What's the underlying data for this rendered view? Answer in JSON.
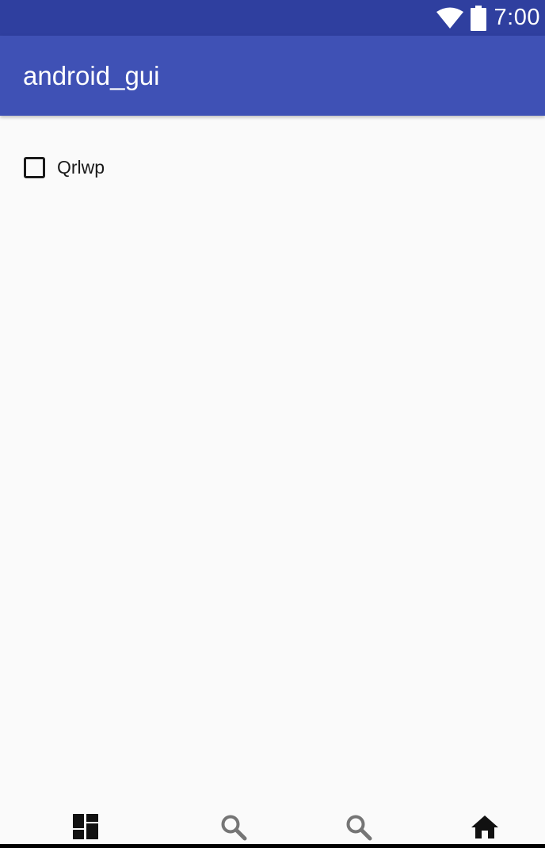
{
  "status_bar": {
    "time": "7:00",
    "icons": [
      "wifi-icon",
      "battery-icon"
    ]
  },
  "app_bar": {
    "title": "android_gui"
  },
  "content": {
    "checkbox": {
      "label": "Qrlwp",
      "checked": false
    }
  },
  "bottom_nav": {
    "items": [
      {
        "icon": "dashboard-icon",
        "color": "#111111"
      },
      {
        "icon": "search-icon",
        "color": "#757575"
      },
      {
        "icon": "search-icon",
        "color": "#757575"
      },
      {
        "icon": "home-icon",
        "color": "#111111"
      }
    ]
  },
  "colors": {
    "status_bar": "#2f3f9f",
    "app_bar": "#3f51b5",
    "background": "#fafafa"
  }
}
